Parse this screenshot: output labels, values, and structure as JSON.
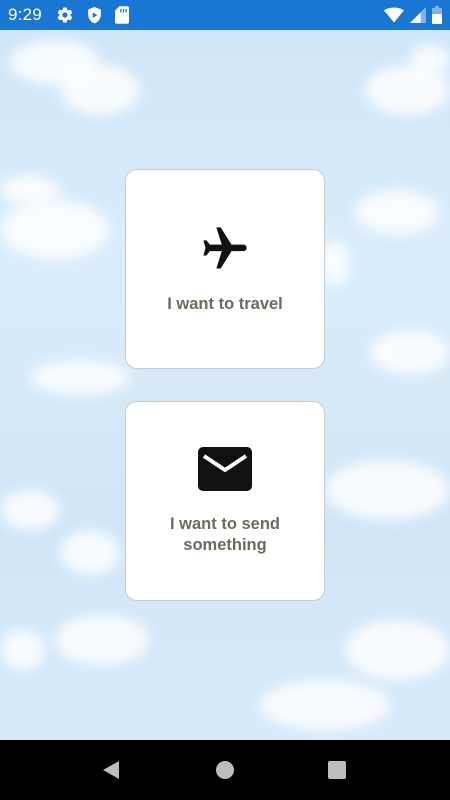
{
  "status_bar": {
    "time": "9:29",
    "left_icons": [
      "gear-icon",
      "shield-icon",
      "sd-card-icon"
    ],
    "right_icons": [
      "wifi-icon",
      "cell-signal-icon",
      "battery-icon"
    ],
    "color": "#1976d2"
  },
  "options": [
    {
      "label": "I want to travel",
      "icon": "airplane-icon"
    },
    {
      "label": "I want to send something",
      "icon": "mail-icon"
    }
  ],
  "nav_bar": {
    "buttons": [
      "back-icon",
      "home-icon",
      "recents-icon"
    ]
  },
  "colors": {
    "card_text": "#6b6b5e",
    "card_border": "#c9c9c9",
    "sky": "#d6ebfa"
  }
}
